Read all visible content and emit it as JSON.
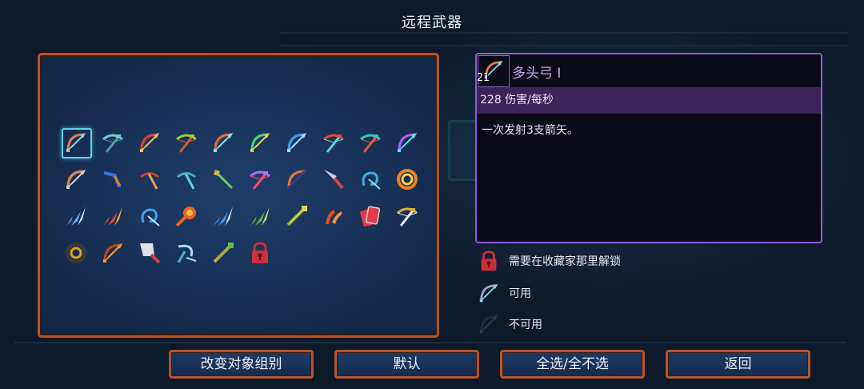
{
  "title": "远程武器",
  "colors": {
    "panel_border": "#b3552f",
    "panel_bg": "#183156",
    "selection": "#5fd3ec",
    "detail_border": "#8b5fd6",
    "dps_bar": "#3d2457",
    "item_name": "#c8a7ec"
  },
  "inventory": {
    "items": [
      {
        "name": "multiple-nocks-bow-icon",
        "icon": "bow",
        "c1": "#e07a4a",
        "c2": "#7fd8e8",
        "selected": true
      },
      {
        "name": "repeater-crossbow-icon",
        "icon": "xbow",
        "c1": "#6fd0c8",
        "c2": "#4aa0a8"
      },
      {
        "name": "quick-bow-icon",
        "icon": "bow",
        "c1": "#d8403a",
        "c2": "#f0c060"
      },
      {
        "name": "heavy-crossbow-icon",
        "icon": "xbow",
        "c1": "#9ad040",
        "c2": "#d06030"
      },
      {
        "name": "infantry-bow-icon",
        "icon": "bow",
        "c1": "#e06a3a",
        "c2": "#8fe0f0"
      },
      {
        "name": "ice-bow-icon",
        "icon": "bow",
        "c1": "#50d070",
        "c2": "#f0d050"
      },
      {
        "name": "dual-bow-icon",
        "icon": "bow",
        "c1": "#3aa0f0",
        "c2": "#9fe0ff"
      },
      {
        "name": "marksman-bow-icon",
        "icon": "xbow",
        "c1": "#e04a3a",
        "c2": "#60d0e0"
      },
      {
        "name": "sonic-crossbow-icon",
        "icon": "xbow",
        "c1": "#40c0c0",
        "c2": "#e06040"
      },
      {
        "name": "magic-bow-icon",
        "icon": "bow",
        "c1": "#b060f0",
        "c2": "#60e0f0"
      },
      {
        "name": "bow-and-endless-quiver-icon",
        "icon": "bow",
        "c1": "#e08a4a",
        "c2": "#d0d0d0"
      },
      {
        "name": "boomerang-icon",
        "icon": "boomerang",
        "c1": "#3a70e0",
        "c2": "#e08030"
      },
      {
        "name": "war-javelin-icon",
        "icon": "pick",
        "c1": "#d04030",
        "c2": "#e0a050"
      },
      {
        "name": "hemorrhage-icon",
        "icon": "pick",
        "c1": "#40b0c0",
        "c2": "#60d0e0"
      },
      {
        "name": "throwing-axe-icon",
        "icon": "spear",
        "c1": "#e0b040",
        "c2": "#70d060"
      },
      {
        "name": "nerves-of-steel-icon",
        "icon": "xbow",
        "c1": "#b070f0",
        "c2": "#ff4a6a"
      },
      {
        "name": "barrels-launcher-icon",
        "icon": "bow",
        "c1": "#e07a40",
        "c2": "#4a3a7a"
      },
      {
        "name": "throwing-knife-icon",
        "icon": "knife",
        "c1": "#d0d0e0",
        "c2": "#e04040"
      },
      {
        "name": "electric-whip-icon",
        "icon": "swirl",
        "c1": "#40b0e0",
        "c2": "#8ae0ff"
      },
      {
        "name": "fire-blast-icon",
        "icon": "ring",
        "c1": "#f08020",
        "c2": "#ffd040"
      },
      {
        "name": "ice-shard-icon",
        "icon": "shards",
        "c1": "#60b0ff",
        "c2": "#cfefff"
      },
      {
        "name": "fireball-icon",
        "icon": "shards",
        "c1": "#e05030",
        "c2": "#ffb040"
      },
      {
        "name": "lightning-bolt-icon",
        "icon": "swirl",
        "c1": "#40a0f0",
        "c2": "#bfe8ff"
      },
      {
        "name": "fire-brands-icon",
        "icon": "burst",
        "c1": "#f06020",
        "c2": "#ffc040"
      },
      {
        "name": "ice-blast-icon",
        "icon": "shards",
        "c1": "#40a0ff",
        "c2": "#e0f4ff"
      },
      {
        "name": "poison-shards-icon",
        "icon": "shards",
        "c1": "#60c040",
        "c2": "#d0f070"
      },
      {
        "name": "magic-staff-icon",
        "icon": "staff",
        "c1": "#90c030",
        "c2": "#e0d060"
      },
      {
        "name": "fire-claw-icon",
        "icon": "claw",
        "c1": "#e04a2a",
        "c2": "#ff9040"
      },
      {
        "name": "card-icon",
        "icon": "card",
        "c1": "#e03a4a",
        "c2": "#f0d0d0"
      },
      {
        "name": "gilded-crossbow-icon",
        "icon": "xbow",
        "c1": "#e0b040",
        "c2": "#f0f0f0"
      },
      {
        "name": "armored-shell-icon",
        "icon": "ring",
        "c1": "#3a3a3a",
        "c2": "#e0a020"
      },
      {
        "name": "scorching-bow-icon",
        "icon": "bow",
        "c1": "#c04020",
        "c2": "#f0a030"
      },
      {
        "name": "cleaver-icon",
        "icon": "cleaver",
        "c1": "#e0e0e8",
        "c2": "#d04040"
      },
      {
        "name": "sickle-icon",
        "icon": "sickle",
        "c1": "#9fe0f0",
        "c2": "#4ab0d0"
      },
      {
        "name": "pyrotechnics-icon",
        "icon": "staff",
        "c1": "#e0a040",
        "c2": "#60c040"
      },
      {
        "name": "locked-item-icon",
        "icon": "lock",
        "c1": "#c8303a",
        "c2": "#5a0a14"
      }
    ]
  },
  "detail": {
    "count": "21",
    "name": "多头弓 I",
    "dps": "228 伤害/每秒",
    "description": "一次发射3支箭矢。"
  },
  "legend": [
    {
      "icon": "lock",
      "text": "需要在收藏家那里解锁"
    },
    {
      "icon": "bow-available",
      "text": "可用"
    },
    {
      "icon": "bow-unavailable",
      "text": "不可用"
    }
  ],
  "buttons": {
    "change_group": "改变对象组别",
    "default": "默认",
    "select_all": "全选/全不选",
    "back": "返回"
  }
}
